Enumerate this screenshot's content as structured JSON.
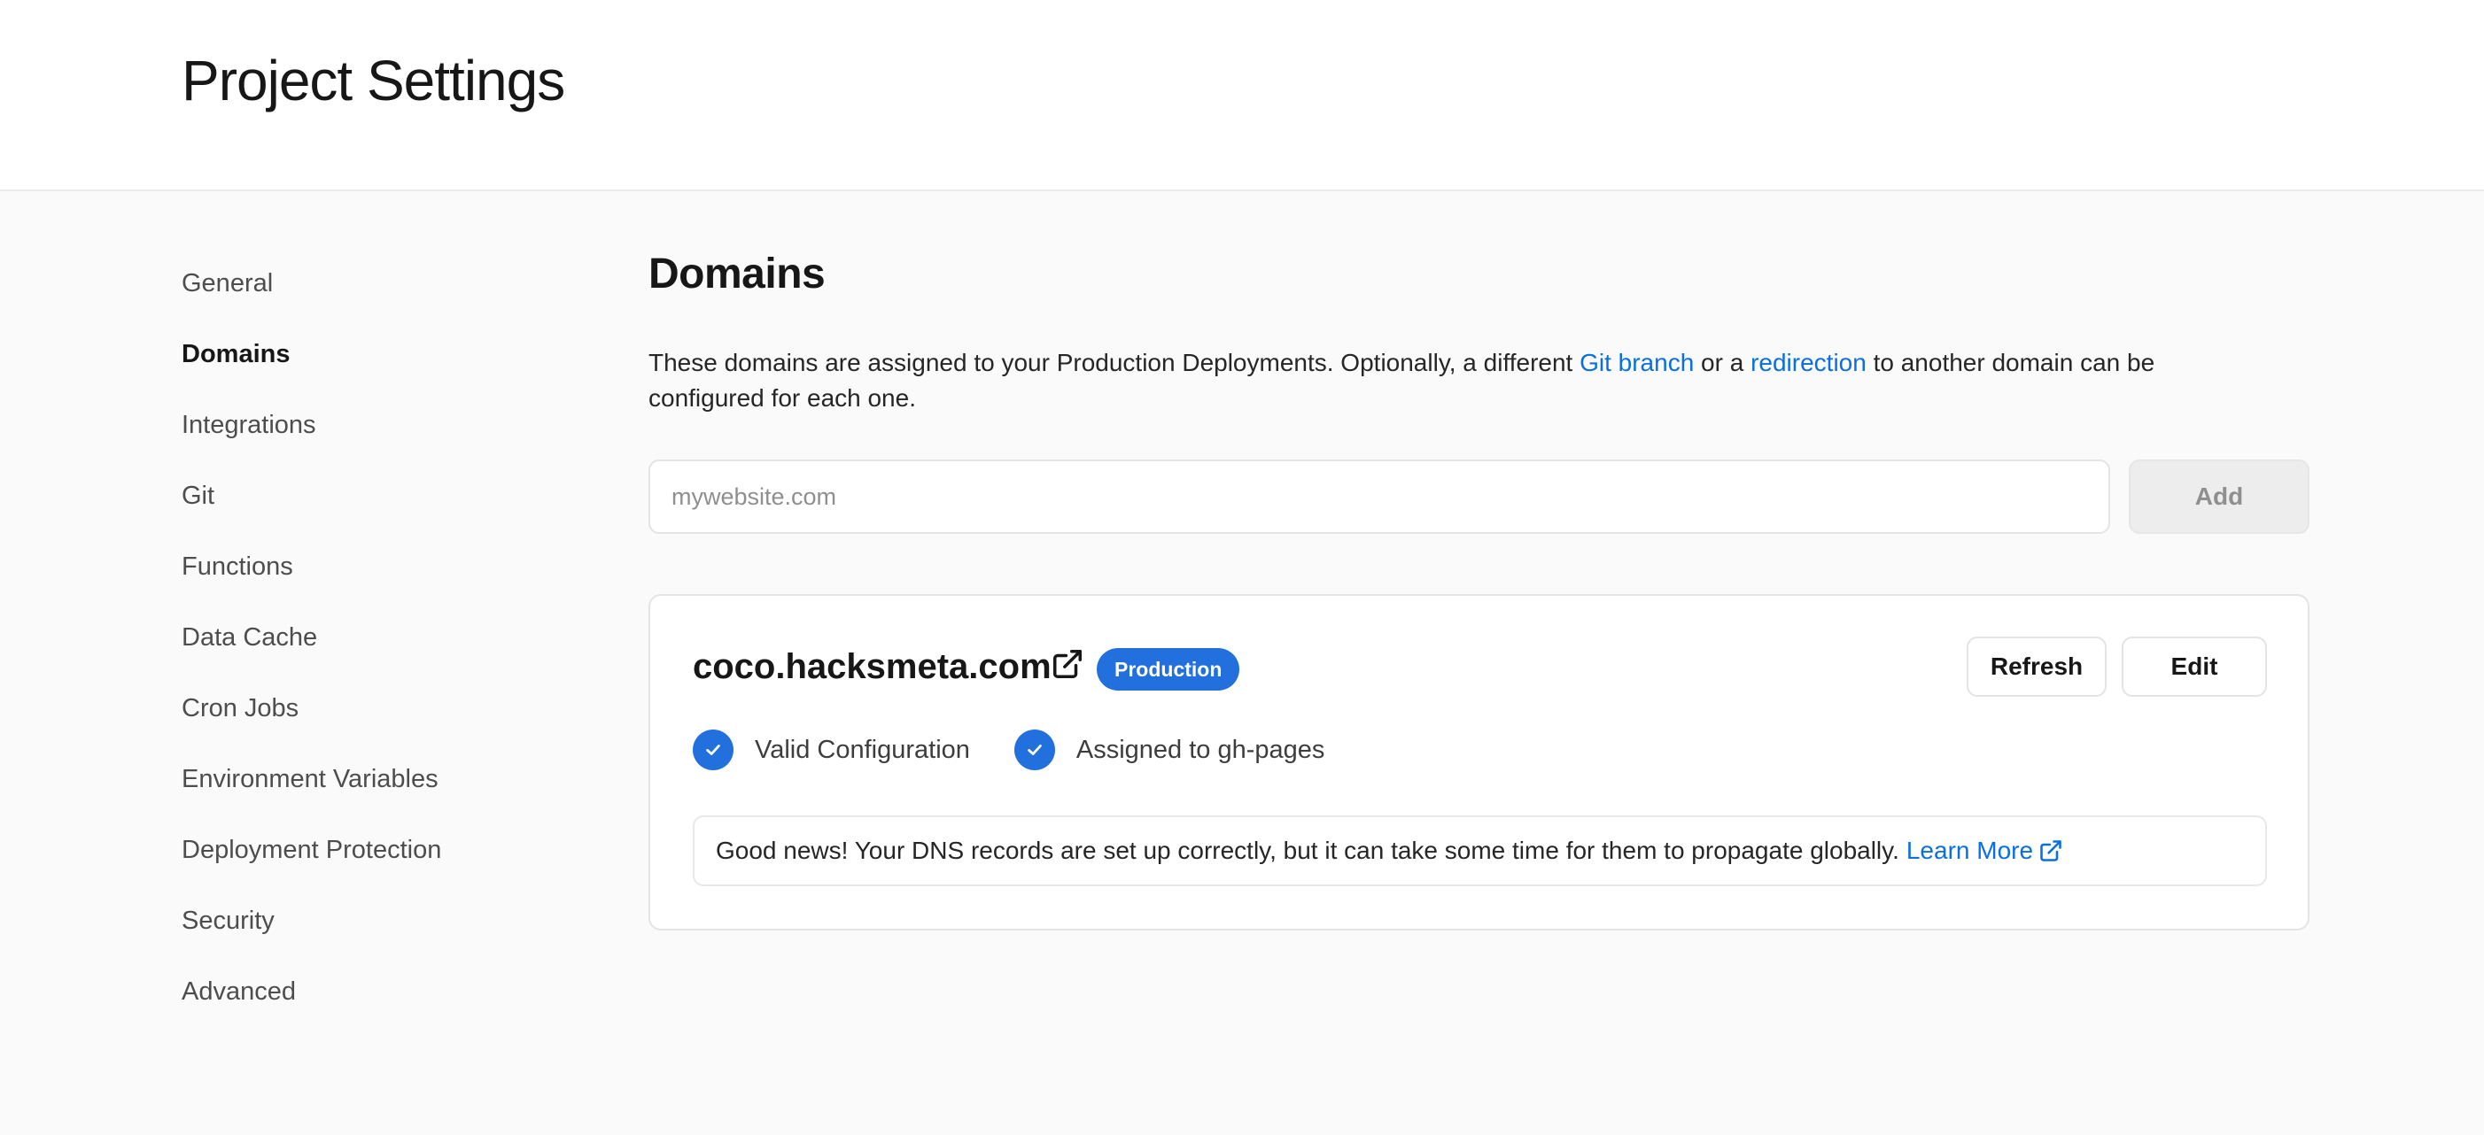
{
  "header": {
    "title": "Project Settings"
  },
  "sidebar": {
    "items": [
      {
        "label": "General"
      },
      {
        "label": "Domains",
        "active": true
      },
      {
        "label": "Integrations"
      },
      {
        "label": "Git"
      },
      {
        "label": "Functions"
      },
      {
        "label": "Data Cache"
      },
      {
        "label": "Cron Jobs"
      },
      {
        "label": "Environment Variables"
      },
      {
        "label": "Deployment Protection"
      },
      {
        "label": "Security"
      },
      {
        "label": "Advanced"
      }
    ]
  },
  "domains": {
    "title": "Domains",
    "description": {
      "part1": "These domains are assigned to your Production Deployments. Optionally, a different ",
      "git_branch_link": "Git branch",
      "part2": " or a ",
      "redirection_link": "redirection",
      "part3": " to another domain can be configured for each one."
    },
    "input": {
      "placeholder": "mywebsite.com",
      "value": ""
    },
    "add_label": "Add",
    "card": {
      "domain": "coco.hacksmeta.com",
      "badge": "Production",
      "refresh_label": "Refresh",
      "edit_label": "Edit",
      "statuses": [
        {
          "label": "Valid Configuration",
          "icon": "check-icon"
        },
        {
          "label": "Assigned to gh-pages",
          "icon": "check-icon"
        }
      ],
      "note": "Good news! Your DNS records are set up correctly, but it can take some time for them to propagate globally.",
      "learn_more": "Learn More"
    }
  },
  "colors": {
    "accent": "#2170de",
    "link": "#0a6fe0",
    "background": "#fafafa"
  }
}
